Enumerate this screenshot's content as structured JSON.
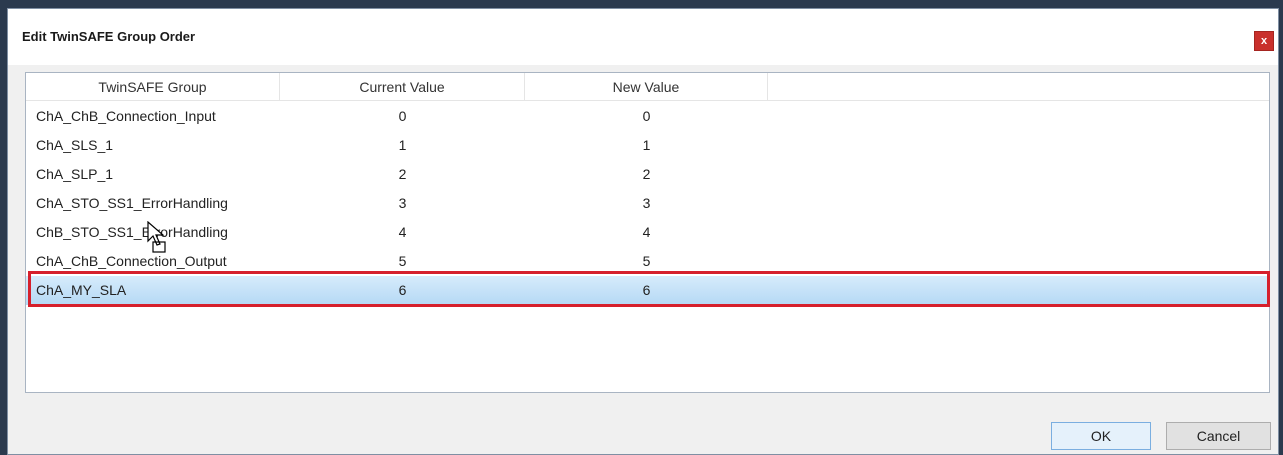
{
  "window": {
    "title": "Edit TwinSAFE Group Order",
    "close_label": "x"
  },
  "list": {
    "columns": [
      "TwinSAFE Group",
      "Current Value",
      "New Value"
    ],
    "rows": [
      {
        "name": "ChA_ChB_Connection_Input",
        "current": "0",
        "new": "0"
      },
      {
        "name": "ChA_SLS_1",
        "current": "1",
        "new": "1"
      },
      {
        "name": "ChA_SLP_1",
        "current": "2",
        "new": "2"
      },
      {
        "name": "ChA_STO_SS1_ErrorHandling",
        "current": "3",
        "new": "3"
      },
      {
        "name": "ChB_STO_SS1_ErrorHandling",
        "current": "4",
        "new": "4"
      },
      {
        "name": "ChA_ChB_Connection_Output",
        "current": "5",
        "new": "5"
      },
      {
        "name": "ChA_MY_SLA",
        "current": "6",
        "new": "6"
      }
    ],
    "selected_row": "ChA_MY_SLA"
  },
  "buttons": {
    "ok_label": "OK",
    "cancel_label": "Cancel"
  },
  "colors": {
    "highlight_border": "#d6202c",
    "selection": "#b5d9f5",
    "close_button": "#c9302c"
  },
  "icons": {
    "cursor": "mouse-pointer-icon",
    "close": "close-icon"
  }
}
